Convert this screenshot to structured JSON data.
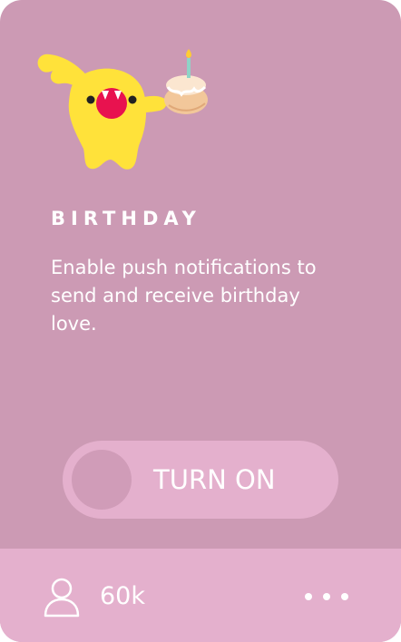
{
  "card": {
    "title": "BIRTHDAY",
    "description": "Enable push notifications to send and receive birthday love.",
    "toggle": {
      "label": "TURN ON",
      "state": "off"
    },
    "footer": {
      "user_count": "60k",
      "user_icon": "user-icon",
      "more_icon": "more-dots-icon"
    },
    "mascot_icon": "birthday-monster-with-cake",
    "colors": {
      "card_background": "#cc9ab4",
      "footer_background": "#e4b0cd",
      "toggle_background": "#e4b0cd",
      "toggle_knob": "#d09cb8",
      "text": "#ffffff",
      "mascot_body": "#ffe23a",
      "mascot_mouth": "#e8124f"
    }
  }
}
